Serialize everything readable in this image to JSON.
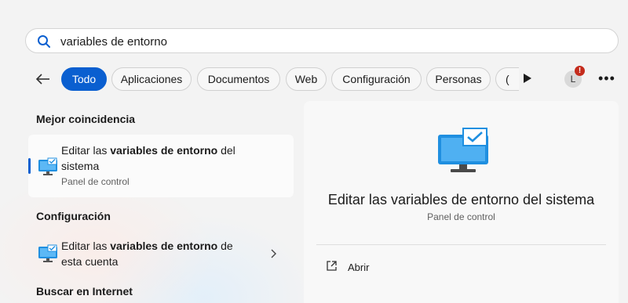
{
  "search": {
    "value": "variables de entorno",
    "icon": "search-icon"
  },
  "filters": {
    "back_icon": "arrow-left-icon",
    "tabs": [
      {
        "label": "Todo",
        "active": true
      },
      {
        "label": "Aplicaciones",
        "active": false
      },
      {
        "label": "Documentos",
        "active": false
      },
      {
        "label": "Web",
        "active": false
      },
      {
        "label": "Configuración",
        "active": false
      },
      {
        "label": "Personas",
        "active": false
      },
      {
        "label": "(",
        "active": false
      }
    ],
    "play_icon": "play-icon",
    "avatar_initial": "L",
    "notification_badge": "!",
    "more_label": "•••"
  },
  "results": {
    "best_match_heading": "Mejor coincidencia",
    "best_match": {
      "title_pre": "Editar las ",
      "title_bold": "variables de entorno",
      "title_post": " del",
      "title_line2": "sistema",
      "subtitle": "Panel de control",
      "icon": "monitor-checkmark-icon"
    },
    "settings_heading": "Configuración",
    "settings_item": {
      "title_pre": "Editar las ",
      "title_bold": "variables de entorno",
      "title_post": " de",
      "title_line2": "esta cuenta",
      "icon": "monitor-checkmark-icon"
    },
    "web_heading": "Buscar en Internet"
  },
  "preview": {
    "title": "Editar las variables de entorno del sistema",
    "subtitle": "Panel de control",
    "open_label": "Abrir",
    "open_icon": "open-external-icon"
  },
  "colors": {
    "accent": "#0a5fd0",
    "badge": "#c42b1c",
    "monitor": "#1f8fe0"
  }
}
